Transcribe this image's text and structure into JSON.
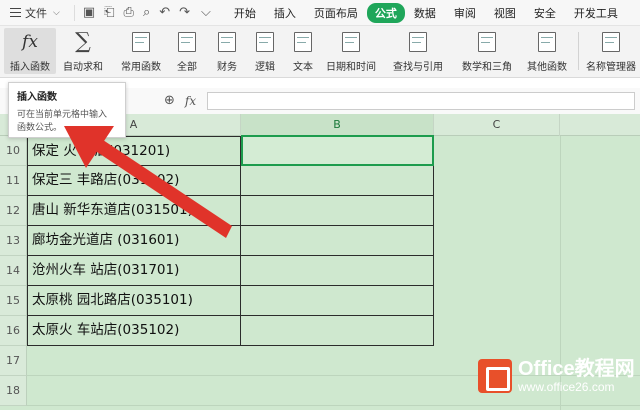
{
  "menubar": {
    "file_label": "文件",
    "tabs": [
      "开始",
      "插入",
      "页面布局",
      "公式",
      "数据",
      "审阅",
      "视图",
      "安全",
      "开发工具"
    ],
    "active_tab": "公式"
  },
  "ribbon": {
    "insert_function": "插入函数",
    "autosum": "自动求和",
    "common": "常用函数",
    "all": "全部",
    "financial": "财务",
    "logical": "逻辑",
    "text": "文本",
    "datetime": "日期和时间",
    "lookup": "查找与引用",
    "math": "数学和三角",
    "other": "其他函数",
    "name_manager": "名称管理器"
  },
  "formula_bar": {
    "fx": "fx",
    "value": ""
  },
  "tooltip": {
    "title": "插入函数",
    "desc_line1": "可在当前单元格中输入",
    "desc_line2": "函数公式。"
  },
  "columns": [
    "A",
    "B",
    "C"
  ],
  "rows": [
    {
      "num": "10",
      "a": "保定  火  站店(031201)"
    },
    {
      "num": "11",
      "a": "保定三   丰路店(031202)"
    },
    {
      "num": "12",
      "a": "唐山    新华东道店(031501)"
    },
    {
      "num": "13",
      "a": "廊坊金光道店   (031601)"
    },
    {
      "num": "14",
      "a": "沧州火车   站店(031701)"
    },
    {
      "num": "15",
      "a": "太原桃    园北路店(035101)"
    },
    {
      "num": "16",
      "a": "太原火   车站店(035102)"
    },
    {
      "num": "17",
      "a": ""
    },
    {
      "num": "18",
      "a": ""
    }
  ],
  "watermark": {
    "title": "Office教程网",
    "url": "www.office26.com"
  },
  "colors": {
    "accent": "#1fa65a",
    "grid_bg": "#cfe8cf",
    "arrow": "#e0332a"
  }
}
